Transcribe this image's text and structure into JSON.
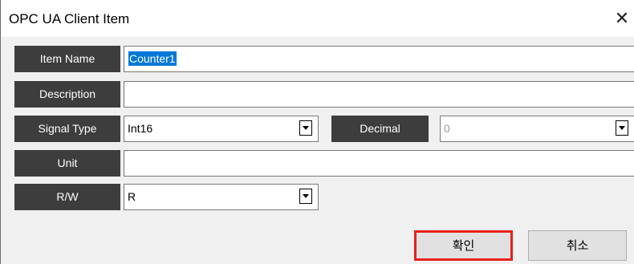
{
  "window": {
    "title": "OPC UA Client Item",
    "close_glyph": "✕"
  },
  "fields": {
    "item_name": {
      "label": "Item Name",
      "value": "Counter1"
    },
    "description": {
      "label": "Description",
      "value": ""
    },
    "signal_type": {
      "label": "Signal Type",
      "value": "Int16"
    },
    "decimal": {
      "label": "Decimal",
      "value": "0"
    },
    "unit": {
      "label": "Unit",
      "value": ""
    },
    "rw": {
      "label": "R/W",
      "value": "R"
    }
  },
  "buttons": {
    "ok": "확인",
    "cancel": "취소"
  },
  "icons": {
    "dropdown": "chevron-down-icon",
    "close": "close-icon"
  },
  "colors": {
    "label_bg": "#3d3d3d",
    "selection": "#0078d7",
    "focus_highlight": "#e8211a"
  }
}
